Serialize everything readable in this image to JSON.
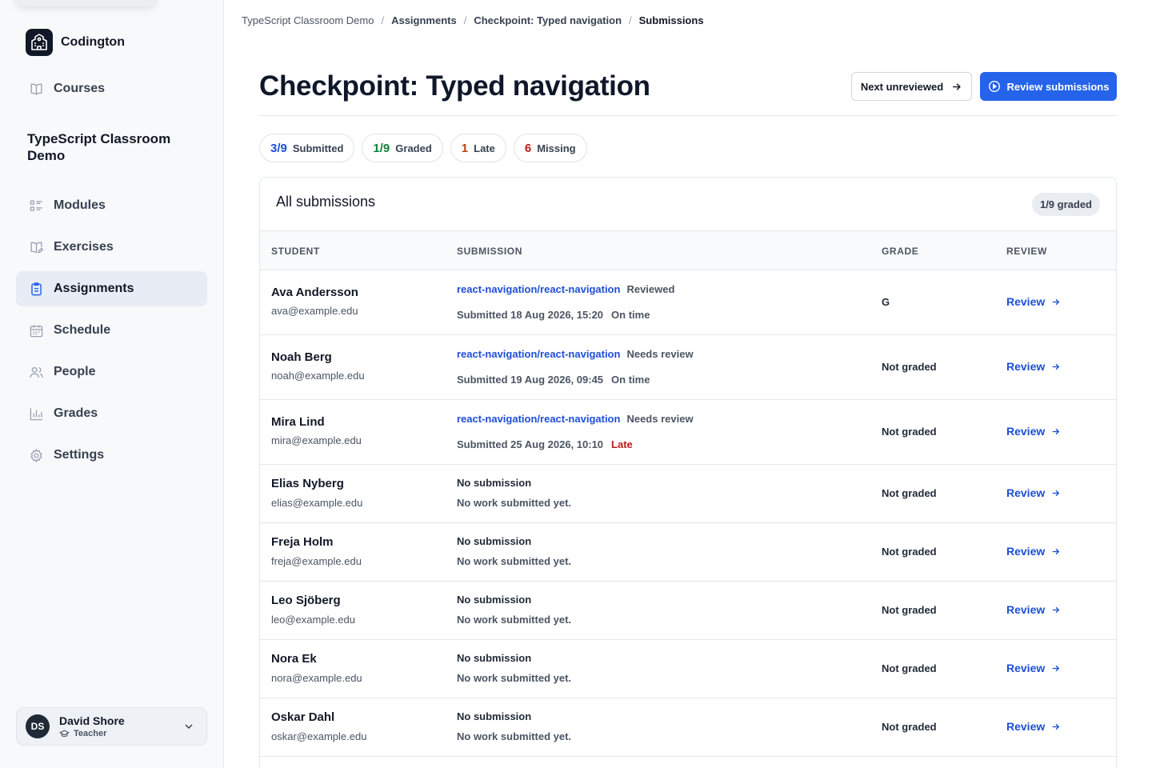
{
  "brand": {
    "name": "Codington"
  },
  "sidebar": {
    "top_item": {
      "label": "Courses",
      "icon": "book-open-icon"
    },
    "course_title": "TypeScript Classroom Demo",
    "items": [
      {
        "label": "Modules",
        "icon": "list-icon"
      },
      {
        "label": "Exercises",
        "icon": "book-edit-icon"
      },
      {
        "label": "Assignments",
        "icon": "clipboard-icon",
        "active": true
      },
      {
        "label": "Schedule",
        "icon": "calendar-icon"
      },
      {
        "label": "People",
        "icon": "users-icon"
      },
      {
        "label": "Grades",
        "icon": "bar-chart-icon"
      },
      {
        "label": "Settings",
        "icon": "gear-icon"
      }
    ],
    "user": {
      "initials": "DS",
      "name": "David Shore",
      "role": "Teacher"
    }
  },
  "breadcrumb": [
    "TypeScript Classroom Demo",
    "Assignments",
    "Checkpoint: Typed navigation",
    "Submissions"
  ],
  "header": {
    "title": "Checkpoint: Typed navigation",
    "next_label": "Next unreviewed",
    "review_label": "Review submissions"
  },
  "stats": [
    {
      "value": "3/9",
      "label": "Submitted",
      "color": "#1d4ed8"
    },
    {
      "value": "1/9",
      "label": "Graded",
      "color": "#15803d"
    },
    {
      "value": "1",
      "label": "Late",
      "color": "#c2410c"
    },
    {
      "value": "6",
      "label": "Missing",
      "color": "#b91c1c"
    }
  ],
  "table": {
    "title": "All submissions",
    "graded_badge": "1/9 graded",
    "columns": [
      "STUDENT",
      "SUBMISSION",
      "GRADE",
      "REVIEW"
    ],
    "rows": [
      {
        "name": "Ava Andersson",
        "email": "ava@example.edu",
        "repo": "react-navigation/react-navigation",
        "status": "Reviewed",
        "submitted": "Submitted 18 Aug 2026, 15:20",
        "timing": "On time",
        "grade": "G",
        "review": "Review"
      },
      {
        "name": "Noah Berg",
        "email": "noah@example.edu",
        "repo": "react-navigation/react-navigation",
        "status": "Needs review",
        "submitted": "Submitted 19 Aug 2026, 09:45",
        "timing": "On time",
        "grade": "Not graded",
        "review": "Review"
      },
      {
        "name": "Mira Lind",
        "email": "mira@example.edu",
        "repo": "react-navigation/react-navigation",
        "status": "Needs review",
        "submitted": "Submitted 25 Aug 2026, 10:10",
        "timing": "Late",
        "grade": "Not graded",
        "review": "Review"
      },
      {
        "name": "Elias Nyberg",
        "email": "elias@example.edu",
        "no_submission": "No submission",
        "no_work": "No work submitted yet.",
        "grade": "Not graded",
        "review": "Review"
      },
      {
        "name": "Freja Holm",
        "email": "freja@example.edu",
        "no_submission": "No submission",
        "no_work": "No work submitted yet.",
        "grade": "Not graded",
        "review": "Review"
      },
      {
        "name": "Leo Sjöberg",
        "email": "leo@example.edu",
        "no_submission": "No submission",
        "no_work": "No work submitted yet.",
        "grade": "Not graded",
        "review": "Review"
      },
      {
        "name": "Nora Ek",
        "email": "nora@example.edu",
        "no_submission": "No submission",
        "no_work": "No work submitted yet.",
        "grade": "Not graded",
        "review": "Review"
      },
      {
        "name": "Oskar Dahl",
        "email": "oskar@example.edu",
        "no_submission": "No submission",
        "no_work": "No work submitted yet.",
        "grade": "Not graded",
        "review": "Review"
      }
    ]
  },
  "colors": {
    "accent": "#2563eb",
    "late": "#b91c1c"
  }
}
